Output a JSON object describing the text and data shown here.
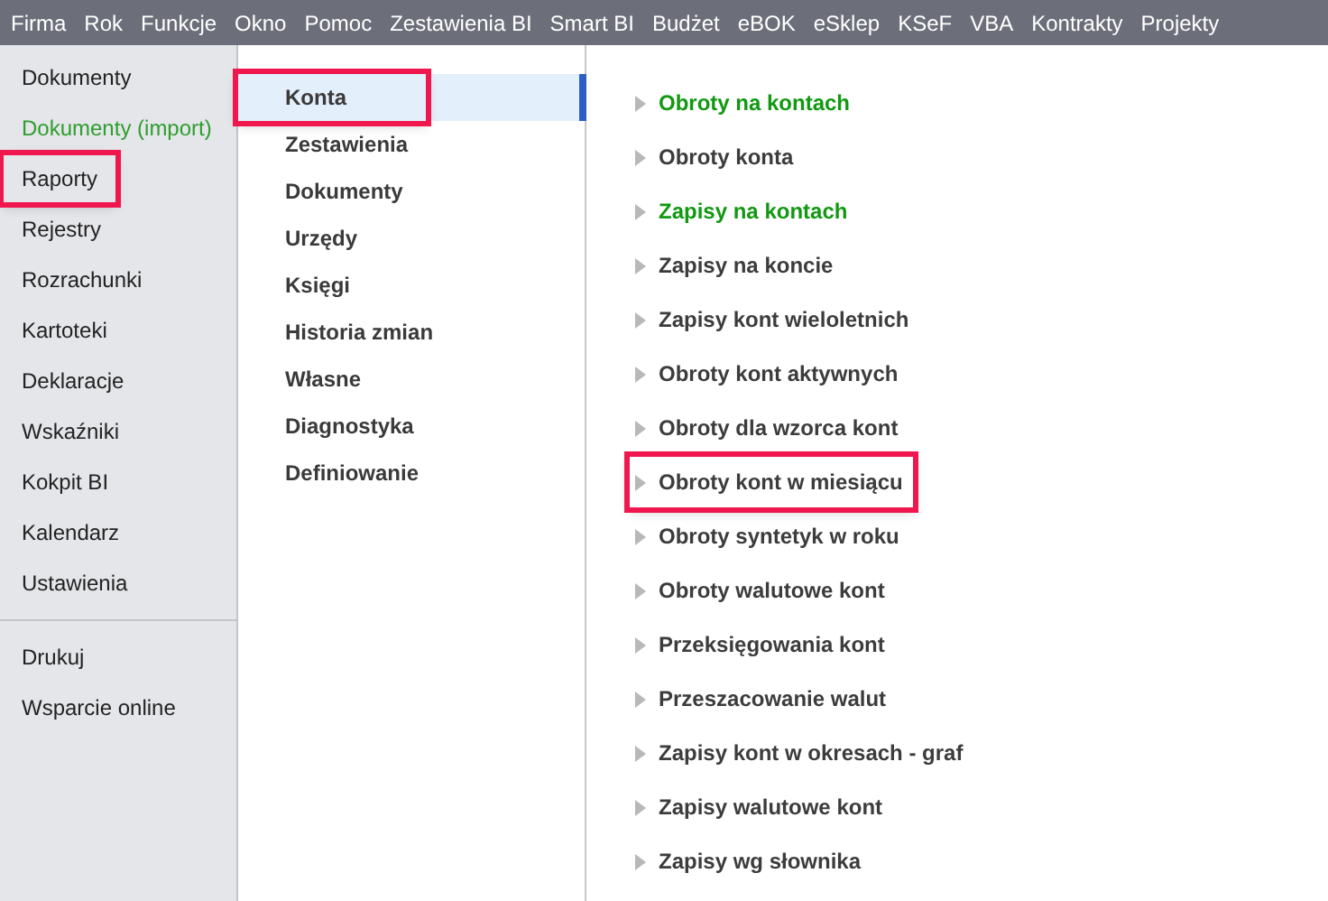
{
  "menu_bar": [
    "Firma",
    "Rok",
    "Funkcje",
    "Okno",
    "Pomoc",
    "Zestawienia BI",
    "Smart BI",
    "Budżet",
    "eBOK",
    "eSklep",
    "KSeF",
    "VBA",
    "Kontrakty",
    "Projekty"
  ],
  "sidebar": {
    "groups": [
      [
        {
          "label": "Dokumenty",
          "color": "#222222",
          "highlighted": false
        },
        {
          "label": "Dokumenty (import)",
          "color": "#2e9e2e",
          "highlighted": false
        },
        {
          "label": "Raporty",
          "color": "#222222",
          "highlighted": true
        },
        {
          "label": "Rejestry",
          "color": "#222222",
          "highlighted": false
        },
        {
          "label": "Rozrachunki",
          "color": "#222222",
          "highlighted": false
        },
        {
          "label": "Kartoteki",
          "color": "#222222",
          "highlighted": false
        },
        {
          "label": "Deklaracje",
          "color": "#222222",
          "highlighted": false
        },
        {
          "label": "Wskaźniki",
          "color": "#222222",
          "highlighted": false
        },
        {
          "label": "Kokpit BI",
          "color": "#222222",
          "highlighted": false
        },
        {
          "label": "Kalendarz",
          "color": "#222222",
          "highlighted": false
        },
        {
          "label": "Ustawienia",
          "color": "#222222",
          "highlighted": false
        }
      ],
      [
        {
          "label": "Drukuj",
          "color": "#222222",
          "highlighted": false
        },
        {
          "label": "Wsparcie online",
          "color": "#222222",
          "highlighted": false
        }
      ]
    ]
  },
  "categories": [
    {
      "label": "Konta",
      "selected": true,
      "highlighted": true
    },
    {
      "label": "Zestawienia",
      "selected": false,
      "highlighted": false
    },
    {
      "label": "Dokumenty",
      "selected": false,
      "highlighted": false
    },
    {
      "label": "Urzędy",
      "selected": false,
      "highlighted": false
    },
    {
      "label": "Księgi",
      "selected": false,
      "highlighted": false
    },
    {
      "label": "Historia zmian",
      "selected": false,
      "highlighted": false
    },
    {
      "label": "Własne",
      "selected": false,
      "highlighted": false
    },
    {
      "label": "Diagnostyka",
      "selected": false,
      "highlighted": false
    },
    {
      "label": "Definiowanie",
      "selected": false,
      "highlighted": false
    }
  ],
  "reports": [
    {
      "label": "Obroty na kontach",
      "color": "#119911",
      "highlighted": false
    },
    {
      "label": "Obroty konta",
      "color": "#3c3c3c",
      "highlighted": false
    },
    {
      "label": "Zapisy na kontach",
      "color": "#119911",
      "highlighted": false
    },
    {
      "label": "Zapisy na koncie",
      "color": "#3c3c3c",
      "highlighted": false
    },
    {
      "label": "Zapisy kont wieloletnich",
      "color": "#3c3c3c",
      "highlighted": false
    },
    {
      "label": "Obroty kont aktywnych",
      "color": "#3c3c3c",
      "highlighted": false
    },
    {
      "label": "Obroty dla wzorca kont",
      "color": "#3c3c3c",
      "highlighted": false
    },
    {
      "label": "Obroty kont w miesiącu",
      "color": "#3c3c3c",
      "highlighted": true
    },
    {
      "label": "Obroty syntetyk w roku",
      "color": "#3c3c3c",
      "highlighted": false
    },
    {
      "label": "Obroty walutowe kont",
      "color": "#3c3c3c",
      "highlighted": false
    },
    {
      "label": "Przeksięgowania kont",
      "color": "#3c3c3c",
      "highlighted": false
    },
    {
      "label": "Przeszacowanie walut",
      "color": "#3c3c3c",
      "highlighted": false
    },
    {
      "label": "Zapisy kont w okresach - graf",
      "color": "#3c3c3c",
      "highlighted": false
    },
    {
      "label": "Zapisy walutowe kont",
      "color": "#3c3c3c",
      "highlighted": false
    },
    {
      "label": "Zapisy wg słownika",
      "color": "#3c3c3c",
      "highlighted": false
    }
  ]
}
